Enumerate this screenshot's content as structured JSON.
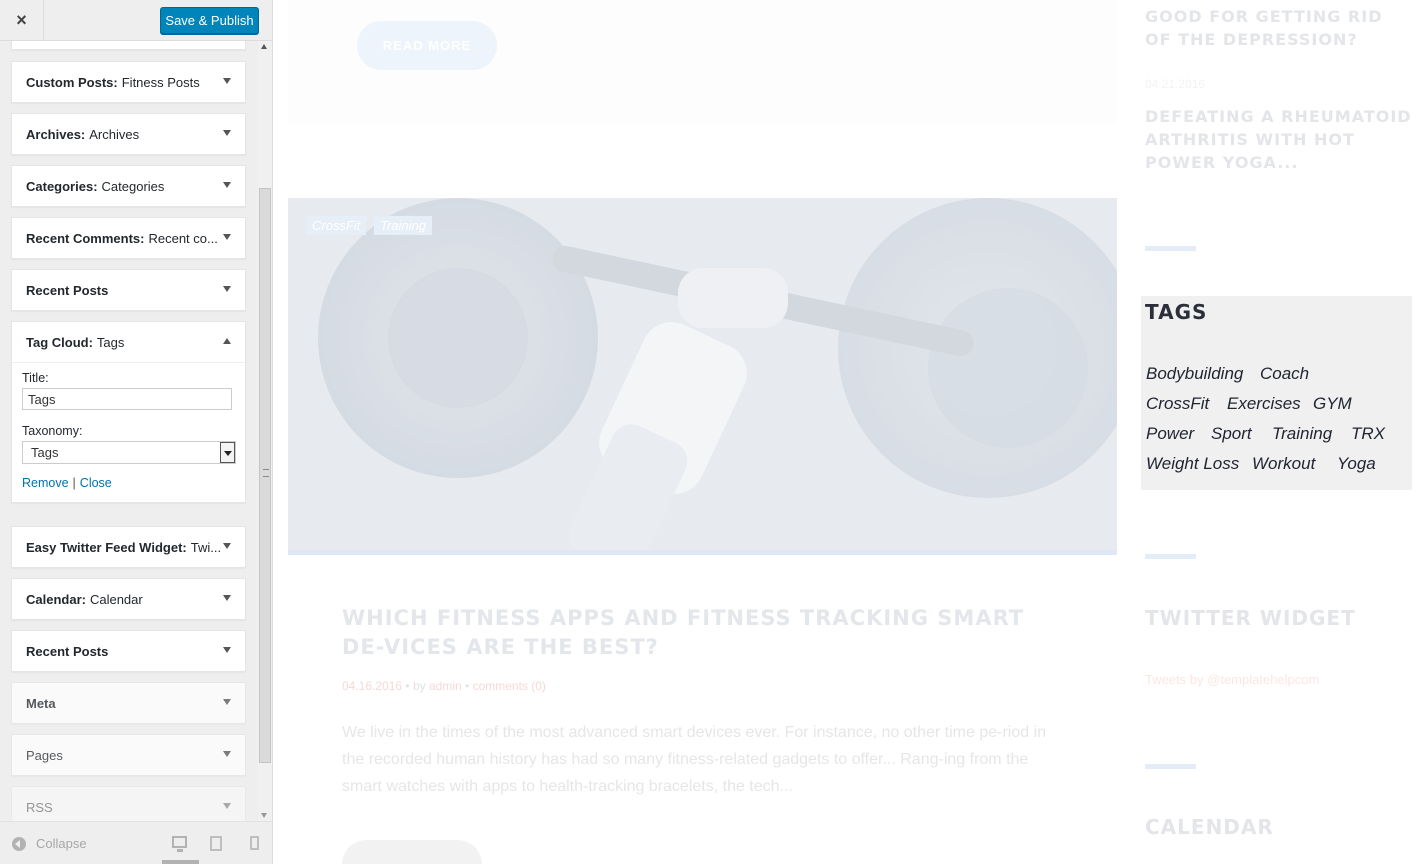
{
  "customizer": {
    "close_icon": "×",
    "publish_label": "Save & Publish",
    "collapse_label": "Collapse",
    "widgets": [
      {
        "title": "",
        "subtitle": ""
      },
      {
        "title": "Custom Posts:",
        "subtitle": "Fitness Posts"
      },
      {
        "title": "Archives:",
        "subtitle": "Archives"
      },
      {
        "title": "Categories:",
        "subtitle": "Categories"
      },
      {
        "title": "Recent Comments:",
        "subtitle": "Recent co..."
      },
      {
        "title": "Recent Posts",
        "subtitle": ""
      },
      {
        "title": "Tag Cloud:",
        "subtitle": "Tags"
      },
      {
        "title": "Easy Twitter Feed Widget:",
        "subtitle": "Twi..."
      },
      {
        "title": "Calendar:",
        "subtitle": "Calendar"
      },
      {
        "title": "Recent Posts",
        "subtitle": ""
      },
      {
        "title": "Meta",
        "subtitle": ""
      },
      {
        "title": "Pages",
        "subtitle": ""
      },
      {
        "title": "RSS",
        "subtitle": ""
      }
    ],
    "tag_cloud_form": {
      "title_label": "Title:",
      "title_value": "Tags",
      "taxonomy_label": "Taxonomy:",
      "taxonomy_value": "Tags",
      "remove_label": "Remove",
      "separator": "|",
      "close_label": "Close"
    }
  },
  "preview": {
    "read_more": "READ MORE",
    "hero_tags": [
      "CrossFit",
      "Training"
    ],
    "post_title": "WHICH FITNESS APPS AND FITNESS TRACKING SMART DE-VICES ARE THE BEST?",
    "post_meta": {
      "date": "04.16.2016",
      "dot": "•",
      "by": "by",
      "author": "admin",
      "comments": "comments (0)"
    },
    "post_excerpt": "We live in the times of the most advanced smart devices ever. For instance, no other time pe-riod in the recorded human history has had so many fitness-related gadgets to offer... Rang-ing from the smart watches with apps to health-tracking bracelets, the tech...",
    "sidebar": {
      "post1_title": "GOOD FOR GETTING RID OF THE DEPRESSION?",
      "post2_date": "04.21.2016",
      "post2_title": "DEFEATING A RHEUMATOID ARTHRITIS WITH HOT POWER YOGA...",
      "tags_title": "TAGS",
      "tags": [
        "Bodybuilding",
        "Coach",
        "CrossFit",
        "Exercises",
        "GYM",
        "Power",
        "Sport",
        "Training",
        "TRX",
        "Weight Loss",
        "Workout",
        "Yoga"
      ],
      "twitter_title": "TWITTER WIDGET",
      "twitter_link": "Tweets by @templatehelpcom",
      "calendar_title": "CALENDAR"
    }
  }
}
